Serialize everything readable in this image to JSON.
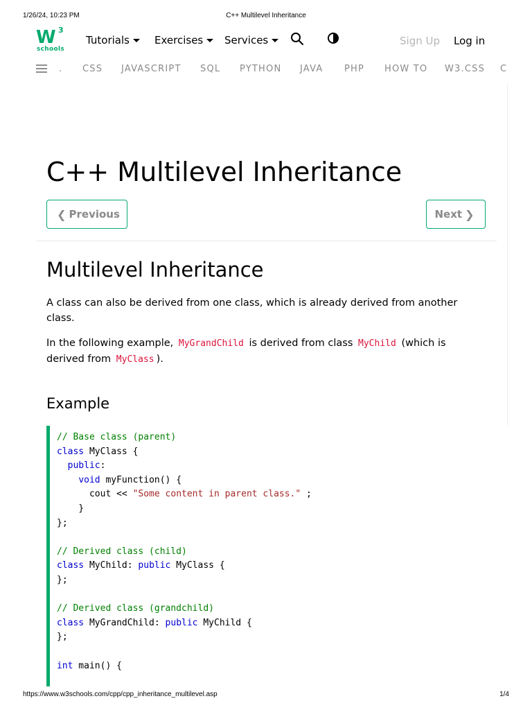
{
  "print_header": {
    "datetime": "1/26/24, 10:23 PM",
    "doc_title": "C++ Multilevel Inheritance"
  },
  "print_footer": {
    "url": "https://www.w3schools.com/cpp/cpp_inheritance_multilevel.asp",
    "page": "1/4"
  },
  "logo": {
    "mark": "W",
    "superscript": "3",
    "wordmark": "schools"
  },
  "nav": {
    "tutorials": "Tutorials",
    "exercises": "Exercises",
    "services": "Services",
    "sign_up": "Sign Up",
    "log_in": "Log in"
  },
  "subjects": [
    ".",
    "CSS",
    "JAVASCRIPT",
    "SQL",
    "PYTHON",
    "JAVA",
    "PHP",
    "HOW TO",
    "W3.CSS",
    "C"
  ],
  "page_title": "C++ Multilevel Inheritance",
  "buttons": {
    "previous": "Previous",
    "next": "Next"
  },
  "section_heading": "Multilevel Inheritance",
  "paragraph1": "A class can also be derived from one class, which is already derived from another class.",
  "paragraph2": {
    "part1": "In the following example,",
    "code1": "MyGrandChild",
    "part2": "is derived from class",
    "code2": "MyChild",
    "part3": "(which is derived from",
    "code3": "MyClass",
    "part4": ")."
  },
  "example_heading": "Example",
  "code_lines": [
    [
      {
        "t": "comment",
        "v": "// Base class (parent)"
      }
    ],
    [
      {
        "t": "kw",
        "v": "class"
      },
      {
        "t": "text",
        "v": " MyClass {"
      }
    ],
    [
      {
        "t": "text",
        "v": "  "
      },
      {
        "t": "kw",
        "v": "public"
      },
      {
        "t": "text",
        "v": ":"
      }
    ],
    [
      {
        "t": "text",
        "v": "    "
      },
      {
        "t": "kw",
        "v": "void"
      },
      {
        "t": "text",
        "v": " myFunction() {"
      }
    ],
    [
      {
        "t": "text",
        "v": "      cout << "
      },
      {
        "t": "str",
        "v": "\"Some content in parent class.\""
      },
      {
        "t": "text",
        "v": " ;"
      }
    ],
    [
      {
        "t": "text",
        "v": "    }"
      }
    ],
    [
      {
        "t": "text",
        "v": "};"
      }
    ],
    [
      {
        "t": "text",
        "v": ""
      }
    ],
    [
      {
        "t": "comment",
        "v": "// Derived class (child)"
      }
    ],
    [
      {
        "t": "kw",
        "v": "class"
      },
      {
        "t": "text",
        "v": " MyChild: "
      },
      {
        "t": "kw",
        "v": "public"
      },
      {
        "t": "text",
        "v": " MyClass {"
      }
    ],
    [
      {
        "t": "text",
        "v": "};"
      }
    ],
    [
      {
        "t": "text",
        "v": ""
      }
    ],
    [
      {
        "t": "comment",
        "v": "// Derived class (grandchild)"
      }
    ],
    [
      {
        "t": "kw",
        "v": "class"
      },
      {
        "t": "text",
        "v": " MyGrandChild: "
      },
      {
        "t": "kw",
        "v": "public"
      },
      {
        "t": "text",
        "v": " MyChild {"
      }
    ],
    [
      {
        "t": "text",
        "v": "};"
      }
    ],
    [
      {
        "t": "text",
        "v": ""
      }
    ],
    [
      {
        "t": "kw",
        "v": "int"
      },
      {
        "t": "text",
        "v": " main() {"
      }
    ]
  ],
  "colors": {
    "accent": "#04AA6D",
    "comment": "#008000",
    "keyword": "#0000cd",
    "string": "#a52a2a",
    "inline_code": "#dc143c"
  },
  "icons": [
    "search-icon",
    "contrast-icon",
    "menu-icon",
    "chevron-left-icon",
    "chevron-right-icon"
  ]
}
